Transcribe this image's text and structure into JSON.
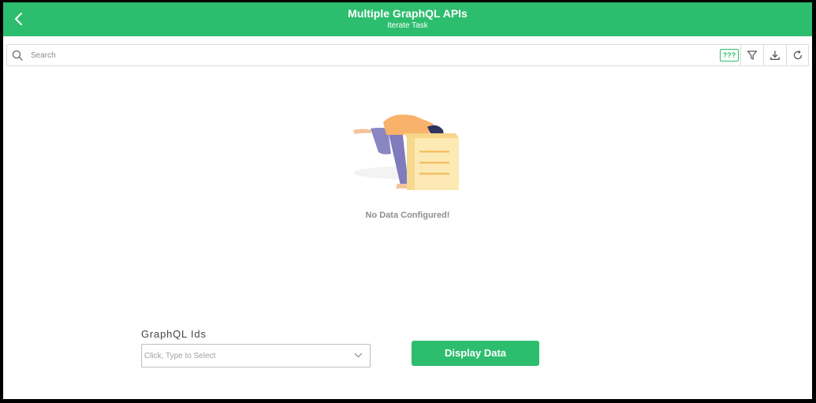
{
  "header": {
    "title": "Multiple GraphQL APIs",
    "subtitle": "Iterate Task",
    "back_icon": "chevron-left-icon"
  },
  "toolbar": {
    "search_placeholder": "Search",
    "search_value": "",
    "badge_label": "???",
    "icons": [
      "search-icon",
      "filter-icon",
      "download-icon",
      "refresh-icon"
    ]
  },
  "empty_state": {
    "message": "No Data Configured!",
    "illustration": "person-in-box-illustration"
  },
  "form": {
    "graphql_label": "GraphQL Ids",
    "graphql_placeholder": "Click, Type to Select",
    "graphql_value": "",
    "display_button_label": "Display Data"
  },
  "colors": {
    "accent": "#2dbd6e",
    "text_muted": "#8e8e8e",
    "border": "#dcdcdc"
  }
}
